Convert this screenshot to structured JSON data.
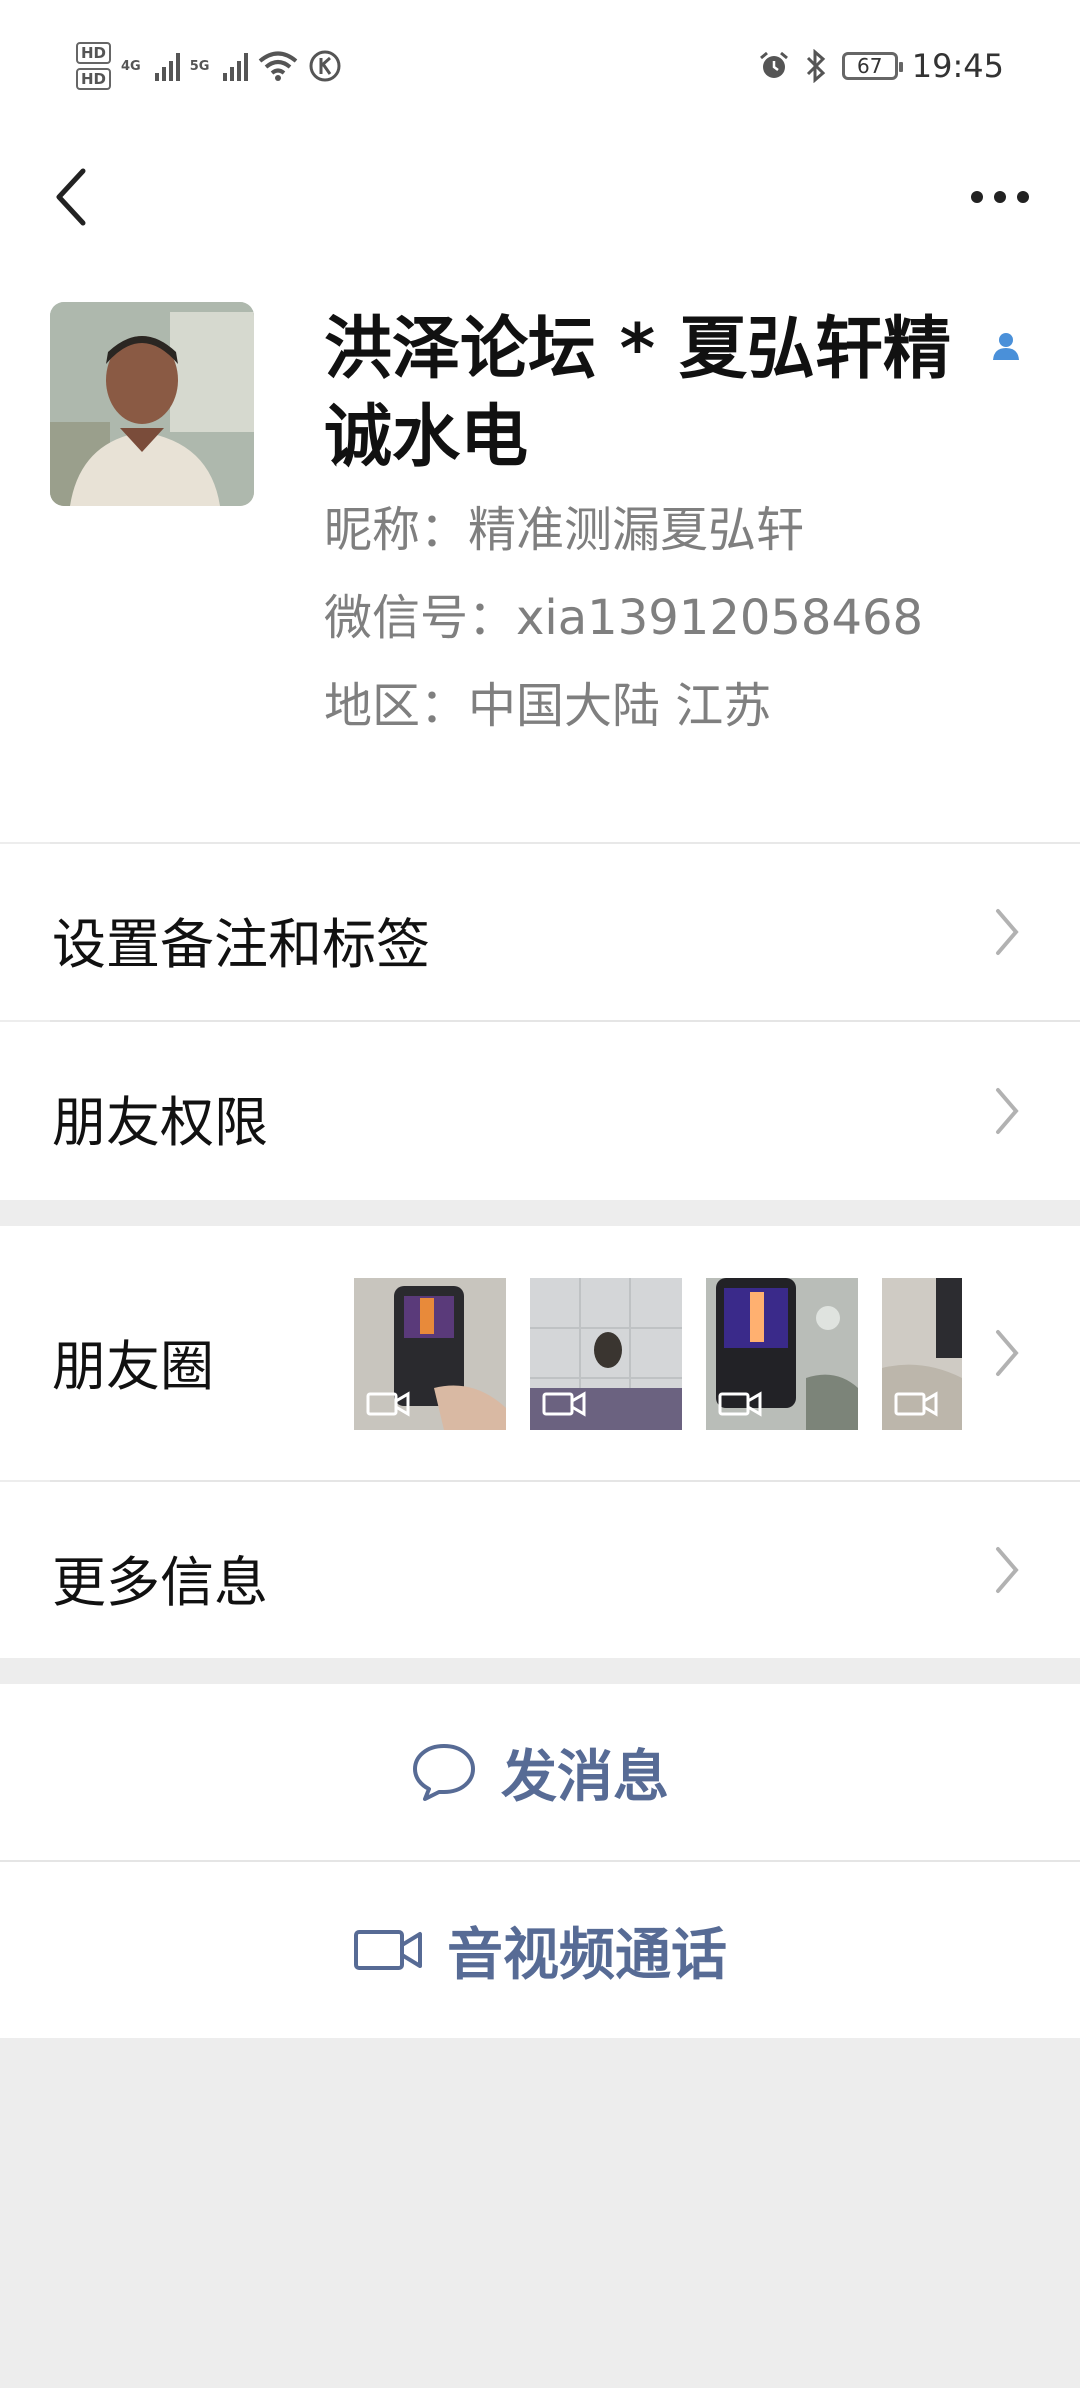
{
  "status_bar": {
    "hd1": "HD",
    "hd2": "HD",
    "net1": "4G",
    "net2": "5G",
    "battery": "67",
    "time": "19:45"
  },
  "profile": {
    "display_name": "洪泽论坛 * 夏弘轩精诚水电",
    "nickname": "昵称：精准测漏夏弘轩",
    "wechat_id": "微信号：xia13912058468",
    "region": "地区：中国大陆  江苏"
  },
  "rows": {
    "set_remark": "设置备注和标签",
    "friend_permissions": "朋友权限",
    "moments": "朋友圈",
    "more_info": "更多信息"
  },
  "actions": {
    "send_message": "发消息",
    "av_call": "音视频通话"
  },
  "colors": {
    "accent_link": "#576b95",
    "background": "#ededed",
    "text": "#111111",
    "secondary_text": "#7f7f7f"
  },
  "icons": {
    "back": "chevron-left-icon",
    "more": "more-dots-icon",
    "contact": "contact-person-icon",
    "chat": "chat-bubble-icon",
    "video": "video-camera-icon"
  }
}
